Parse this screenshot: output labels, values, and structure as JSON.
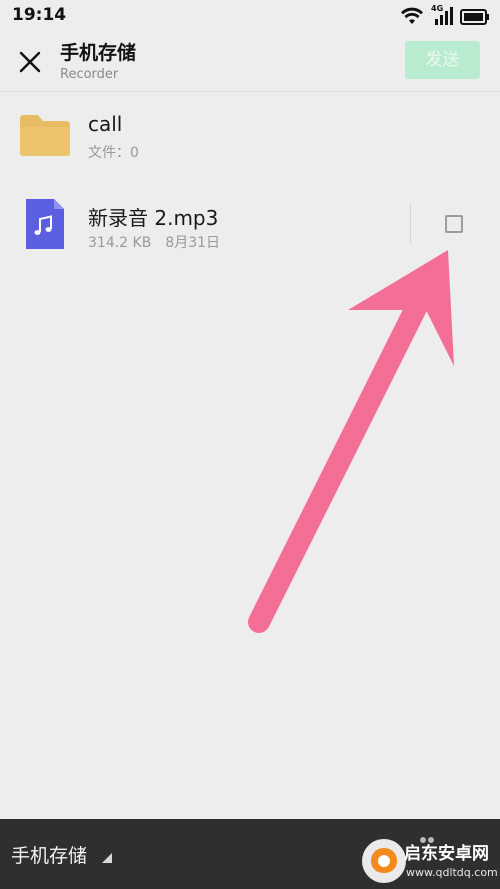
{
  "status_bar": {
    "time": "19:14",
    "network": "4G"
  },
  "header": {
    "title": "手机存储",
    "subtitle": "Recorder",
    "send_label": "发送"
  },
  "files": [
    {
      "type": "folder",
      "name": "call",
      "meta": "文件：0"
    },
    {
      "type": "audio",
      "name": "新录音 2.mp3",
      "size": "314.2 KB",
      "date": "8月31日",
      "checked": false
    }
  ],
  "bottom_bar": {
    "storage_label": "手机存储"
  },
  "watermark": {
    "title": "启东安卓网",
    "url": "www.qdltdq.com"
  },
  "colors": {
    "background": "#ededed",
    "send_button": "#b9ebcf",
    "folder": "#e6bd63",
    "audio_file": "#5b5fe0",
    "arrow_annotation": "#f36f95",
    "bottom_bar": "#2f2f2f"
  }
}
